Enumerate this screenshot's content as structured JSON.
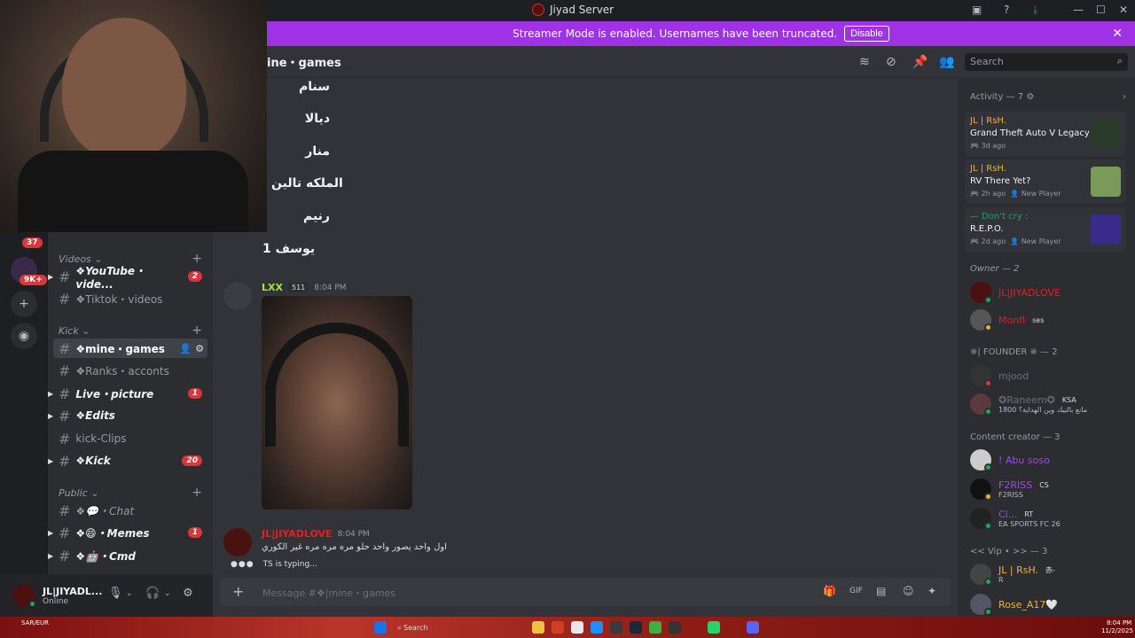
{
  "window": {
    "title": "Jiyad Server"
  },
  "banner": {
    "text": "Streamer Mode is enabled. Usernames have been truncated.",
    "disable_label": "Disable"
  },
  "guilds": {
    "badge_top": "37",
    "badge_mid": "9K+"
  },
  "channel_header": {
    "name": "ine・games",
    "search_placeholder": "Search"
  },
  "sidebar": {
    "categories": [
      {
        "name": "Videos",
        "channels": [
          {
            "name": "❖YouTube・vide...",
            "count": "2",
            "bold": true,
            "arrow": true
          },
          {
            "name": "❖Tiktok・videos",
            "count": "",
            "bold": false,
            "arrow": false
          }
        ]
      },
      {
        "name": "Kick",
        "channels": [
          {
            "name": "❖mine・games",
            "count": "",
            "active": true,
            "arrow": false
          },
          {
            "name": "❖Ranks・acconts",
            "count": "",
            "bold": false,
            "arrow": false
          },
          {
            "name": "Live・picture",
            "count": "1",
            "bold": true,
            "arrow": true
          },
          {
            "name": "❖Edits",
            "count": "",
            "bold": true,
            "arrow": true
          },
          {
            "name": "kick-Clips",
            "count": "",
            "bold": false,
            "arrow": false
          },
          {
            "name": "❖Kick",
            "count": "20",
            "bold": true,
            "arrow": true
          }
        ]
      },
      {
        "name": "Public",
        "channels": [
          {
            "name": "❖💬・Chat",
            "count": "",
            "bold": false,
            "arrow": false
          },
          {
            "name": "❖😄・Memes",
            "count": "1",
            "bold": true,
            "arrow": true
          },
          {
            "name": "❖🤖・Cmd",
            "count": "",
            "bold": true,
            "arrow": true
          }
        ]
      }
    ]
  },
  "user_panel": {
    "name": "JL|JIYADL...",
    "status": "Online"
  },
  "messages": {
    "arabic_lines": [
      "سنام",
      "ديالا",
      "منار",
      "الملكه تالين",
      "رنيم",
      "يوسف 1"
    ],
    "msg1": {
      "author": "LXX",
      "tag": "511",
      "time": "8:04 PM"
    },
    "msg2": {
      "author": "JL|JIYADLOVE",
      "time": "8:04 PM",
      "text": "اول واحد يصور واحد حلو مره مره مره غير الكوري"
    },
    "typing": "TS is typing..."
  },
  "composer": {
    "placeholder": "Message #❖|mine・games"
  },
  "members": {
    "activity_title": "Activity — 7",
    "activities": [
      {
        "who": "JL | RsH.",
        "game": "Grand Theft Auto V Legacy",
        "when": "3d ago",
        "extra": ""
      },
      {
        "who": "JL | RsH.",
        "game": "RV There Yet?",
        "when": "2h ago",
        "extra": "New Player"
      },
      {
        "who": "— Don't cry :",
        "game": "R.E.P.O.",
        "when": "2d ago",
        "extra": "New Player"
      }
    ],
    "sections": [
      {
        "title": "Owner — 2"
      },
      {
        "title": "※| FOUNDER ※ — 2"
      },
      {
        "title": "Content creator — 3"
      },
      {
        "title": "<< Vip • >> — 3"
      }
    ],
    "list": [
      {
        "name": "JL|JIYADLOVE",
        "sub": "",
        "tag": "",
        "color": "#e02020"
      },
      {
        "name": "Monfl",
        "sub": "",
        "tag": "ses",
        "color": "#e02020"
      },
      {
        "name": "mjood",
        "sub": "",
        "tag": "",
        "color": "#6d6f78"
      },
      {
        "name": "✪Raneem✪",
        "sub": "1800 مانع بالنيك وين الهداية؟",
        "tag": "KSA",
        "color": "#6d6f78"
      },
      {
        "name": "! Abu soso",
        "sub": "",
        "tag": "",
        "color": "#a04adf"
      },
      {
        "name": "F2RISS",
        "sub": "F2RISS",
        "tag": "CS",
        "color": "#a04adf"
      },
      {
        "name": "Cl...",
        "sub": "EA SPORTS FC 26",
        "tag": "RT",
        "color": "#a04adf"
      },
      {
        "name": "JL | RsH.",
        "sub": "R",
        "tag": "赤-",
        "color": "#f0b232"
      },
      {
        "name": "Rose_A17🤍",
        "sub": "",
        "tag": "",
        "color": "#f0b232"
      }
    ]
  },
  "taskbar": {
    "currency": "SAR/EUR",
    "search": "Search",
    "time": "8:04 PM",
    "date": "11/2/2025"
  }
}
